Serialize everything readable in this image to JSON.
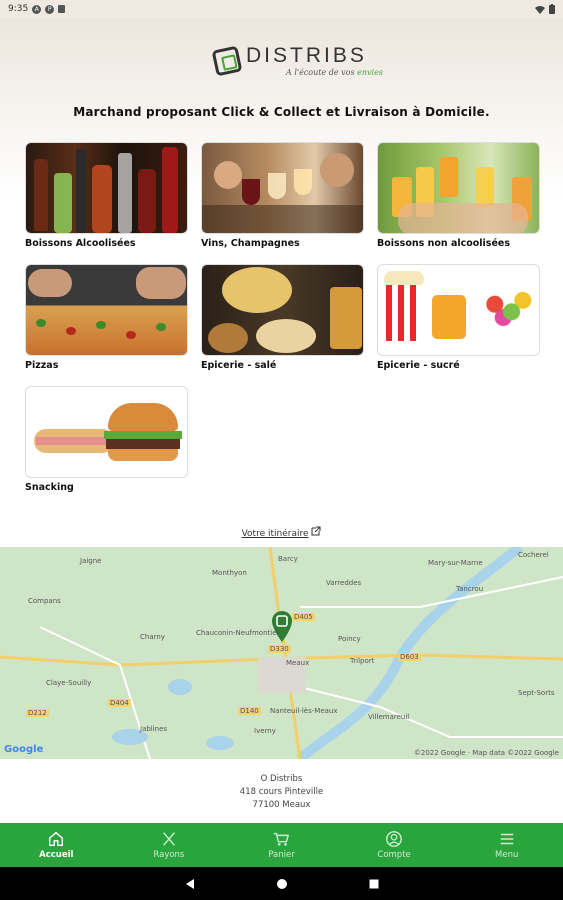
{
  "status_bar": {
    "time": "9:35"
  },
  "brand": {
    "name": "DISTRIBS",
    "tagline_prefix": "A l'écoute de vos ",
    "tagline_accent": "envies"
  },
  "headline": "Marchand proposant Click & Collect et Livraison à Domicile.",
  "categories": [
    {
      "label": "Boissons Alcoolisées",
      "icon": "alcohol-bottles-image"
    },
    {
      "label": "Vins, Champagnes",
      "icon": "wine-toast-image"
    },
    {
      "label": "Boissons non alcoolisées",
      "icon": "soft-drinks-image"
    },
    {
      "label": "Pizzas",
      "icon": "pizza-image"
    },
    {
      "label": "Epicerie - salé",
      "icon": "chips-snacks-image"
    },
    {
      "label": "Epicerie - sucré",
      "icon": "popcorn-candy-image"
    },
    {
      "label": "Snacking",
      "icon": "sandwich-burger-image"
    }
  ],
  "itinerary_link": "Votre itinéraire",
  "map": {
    "towns": [
      "Cocherel",
      "Mary-sur-Marne",
      "Jaigne",
      "Barcy",
      "Monthyon",
      "Varreddes",
      "Tancrou",
      "Compans",
      "Chauconin-Neufmontiers",
      "Poincy",
      "Charny",
      "Trilport",
      "Meaux",
      "Claye-Souilly",
      "Nanteuil-lès-Meaux",
      "Sept-Sorts",
      "Villemareuil",
      "Iverny",
      "Jablines"
    ],
    "roads": [
      "D405",
      "D603",
      "D140",
      "D404",
      "D330",
      "D212"
    ],
    "copyright": "©2022 Google · Map data ©2022 Google",
    "google_logo": "Google",
    "pin_color": "#2e7d32"
  },
  "address": {
    "name": "O Distribs",
    "street": "418 cours Pinteville",
    "city": "77100 Meaux"
  },
  "bottom_nav": [
    {
      "label": "Accueil",
      "icon": "home-icon",
      "active": true
    },
    {
      "label": "Rayons",
      "icon": "utensils-icon",
      "active": false
    },
    {
      "label": "Panier",
      "icon": "cart-icon",
      "active": false
    },
    {
      "label": "Compte",
      "icon": "account-icon",
      "active": false
    },
    {
      "label": "Menu",
      "icon": "menu-icon",
      "active": false
    }
  ],
  "colors": {
    "accent": "#2aa53e",
    "brand_green": "#4aa33a"
  }
}
